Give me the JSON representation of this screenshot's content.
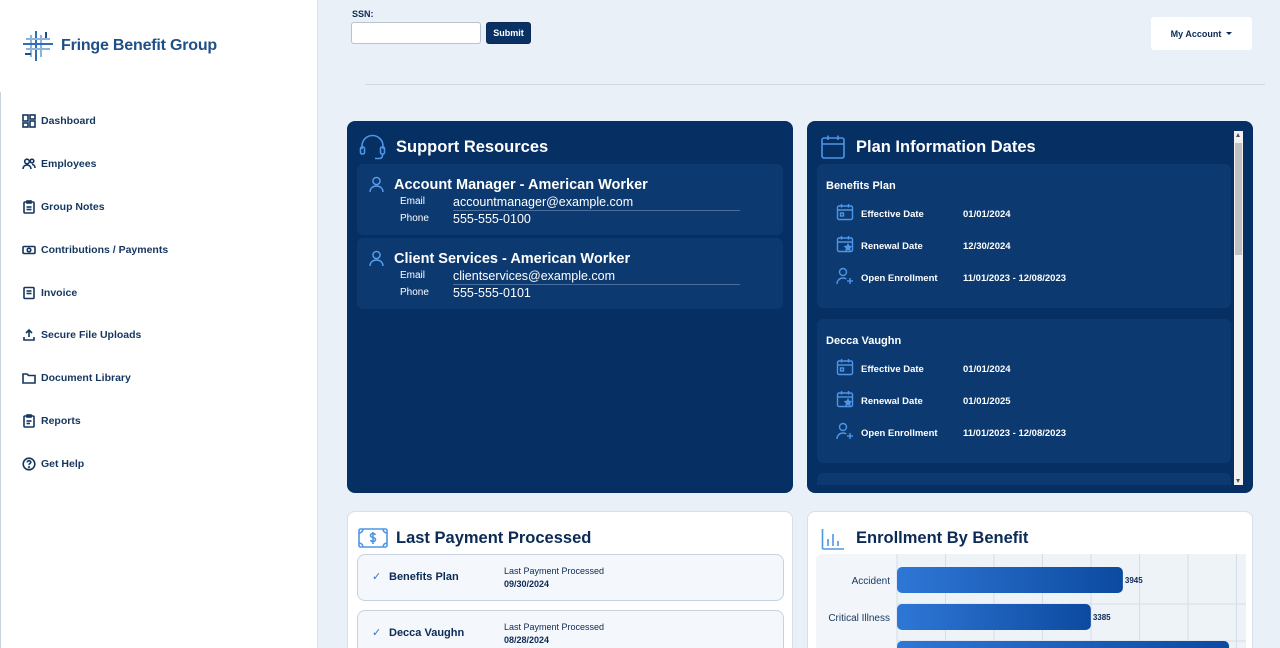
{
  "brand": {
    "name": "Fringe Benefit Group"
  },
  "sidebar": {
    "items": [
      {
        "label": "Dashboard",
        "icon": "dashboard-icon"
      },
      {
        "label": "Employees",
        "icon": "users-icon"
      },
      {
        "label": "Group Notes",
        "icon": "clipboard-icon"
      },
      {
        "label": "Contributions / Payments",
        "icon": "money-icon"
      },
      {
        "label": "Invoice",
        "icon": "receipt-icon"
      },
      {
        "label": "Secure File Uploads",
        "icon": "upload-icon"
      },
      {
        "label": "Document Library",
        "icon": "folder-icon"
      },
      {
        "label": "Reports",
        "icon": "report-icon"
      },
      {
        "label": "Get Help",
        "icon": "help-icon"
      }
    ]
  },
  "topbar": {
    "ssn_label": "SSN:",
    "ssn_value": "",
    "submit_label": "Submit",
    "account_label": "My Account"
  },
  "support": {
    "title": "Support Resources",
    "email_label": "Email",
    "phone_label": "Phone",
    "contacts": [
      {
        "name": "Account Manager - American Worker",
        "email": "accountmanager@example.com",
        "phone": "555-555-0100"
      },
      {
        "name": "Client Services - American Worker",
        "email": "clientservices@example.com",
        "phone": "555-555-0101"
      }
    ]
  },
  "plans": {
    "title": "Plan Information Dates",
    "effective_label": "Effective Date",
    "renewal_label": "Renewal Date",
    "enrollment_label": "Open Enrollment",
    "items": [
      {
        "name": "Benefits Plan",
        "effective": "01/01/2024",
        "renewal": "12/30/2024",
        "enrollment": "11/01/2023 - 12/08/2023"
      },
      {
        "name": "Decca Vaughn",
        "effective": "01/01/2024",
        "renewal": "01/01/2025",
        "enrollment": "11/01/2023 - 12/08/2023"
      }
    ]
  },
  "payments": {
    "title": "Last Payment Processed",
    "label": "Last Payment Processed",
    "items": [
      {
        "name": "Benefits Plan",
        "date": "09/30/2024"
      },
      {
        "name": "Decca Vaughn",
        "date": "08/28/2024"
      }
    ]
  },
  "enrollment": {
    "title": "Enrollment By Benefit"
  },
  "colors": {
    "navy": "#062f63",
    "accent": "#1f5fb8",
    "background": "#e9f0f8"
  },
  "chart_data": {
    "type": "bar",
    "orientation": "horizontal",
    "categories": [
      "Accident",
      "Critical Illness",
      ""
    ],
    "values": [
      3945,
      3385,
      5800
    ],
    "data_labels": [
      "3945",
      "3385",
      ""
    ],
    "xlim": [
      0,
      6200
    ],
    "grid": true
  }
}
